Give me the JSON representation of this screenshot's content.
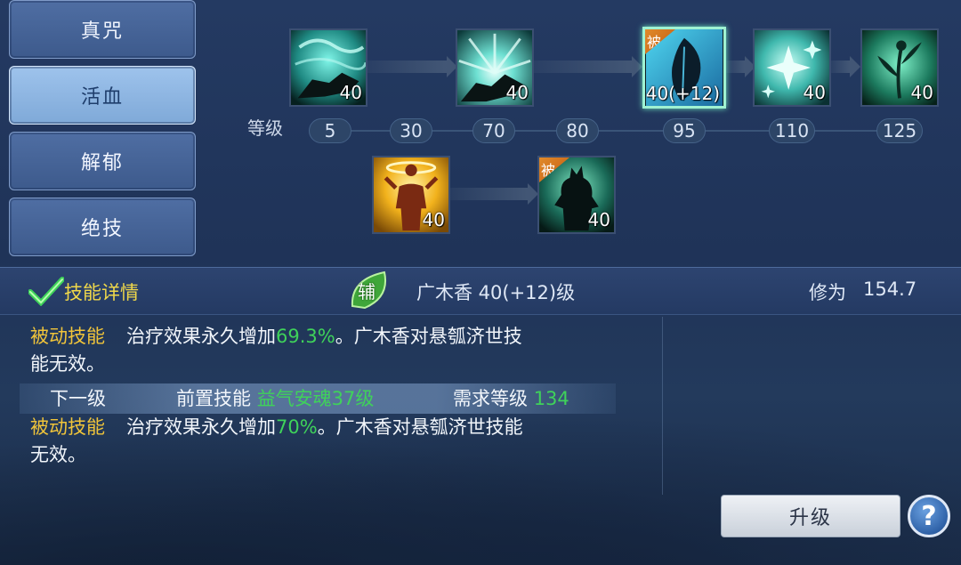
{
  "tabs": [
    {
      "label": "真咒",
      "active": false
    },
    {
      "label": "活血",
      "active": true
    },
    {
      "label": "解郁",
      "active": false
    },
    {
      "label": "绝技",
      "active": false
    }
  ],
  "skill_tree": {
    "level_label": "等级",
    "row1": [
      {
        "level": "40",
        "passive": false,
        "icon": "dragon-wave-icon"
      },
      {
        "level": "40",
        "passive": false,
        "icon": "dragon-sun-icon"
      },
      {
        "level": "40(+12)",
        "passive": true,
        "passive_label": "被",
        "icon": "leaf-icon",
        "selected": true
      },
      {
        "level": "40",
        "passive": false,
        "icon": "sparkle-icon"
      },
      {
        "level": "40",
        "passive": false,
        "icon": "flower-icon"
      }
    ],
    "row2": [
      {
        "level": "40",
        "passive": false,
        "icon": "golden-figure-icon"
      },
      {
        "level": "40",
        "passive": true,
        "passive_label": "被",
        "icon": "beast-silhouette-icon"
      }
    ],
    "level_steps": [
      "5",
      "30",
      "70",
      "80",
      "95",
      "110",
      "125"
    ]
  },
  "detail": {
    "header_title": "技能详情",
    "type_badge": "辅",
    "skill_name": "广木香 40(+12)级",
    "xiuwei_label": "修为",
    "xiuwei_value": "154.7",
    "current": {
      "tag": "被动技能",
      "text_before": "治疗效果永久增加",
      "highlight": "69.3%",
      "text_after": "。广木香对悬瓠济世技",
      "line2": "能无效。"
    },
    "next": {
      "label": "下一级",
      "prereq_label": "前置技能",
      "prereq_value": "益气安魂37级",
      "req_label": "需求等级",
      "req_value": "134"
    },
    "next_effect": {
      "tag": "被动技能",
      "text_before": "治疗效果永久增加",
      "highlight": "70%",
      "text_after": "。广木香对悬瓠济世技能",
      "line2": "无效。"
    }
  },
  "buttons": {
    "upgrade": "升级",
    "help": "?"
  },
  "colors": {
    "highlight_green": "#3fd25a",
    "tag_yellow": "#f0c43a",
    "selected_border": "#9ff2d2"
  }
}
